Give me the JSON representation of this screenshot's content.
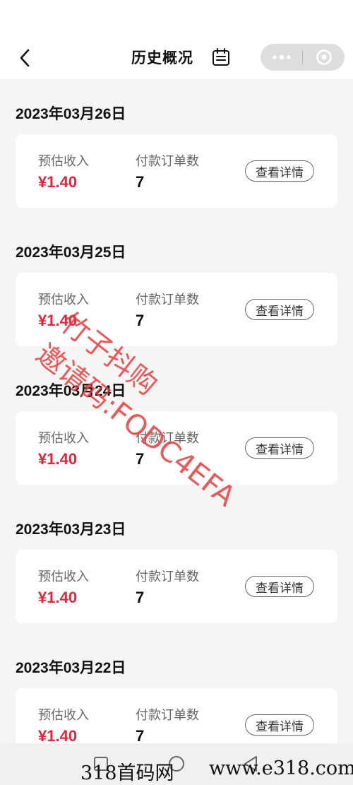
{
  "header": {
    "title": "历史概况"
  },
  "icons": {
    "back": "chevron-left-icon",
    "calendar": "calendar-icon",
    "more": "more-dots-icon",
    "close": "target-close-icon"
  },
  "labels": {
    "income": "预估收入",
    "orders": "付款订单数",
    "detail": "查看详情"
  },
  "records": [
    {
      "date": "2023年03月26日",
      "income": "¥1.40",
      "orders": "7"
    },
    {
      "date": "2023年03月25日",
      "income": "¥1.40",
      "orders": "7"
    },
    {
      "date": "2023年03月24日",
      "income": "¥1.40",
      "orders": "7"
    },
    {
      "date": "2023年03月23日",
      "income": "¥1.40",
      "orders": "7"
    },
    {
      "date": "2023年03月22日",
      "income": "¥1.40",
      "orders": "7"
    }
  ],
  "watermark": {
    "line1": "邀请码:FODC4EFA",
    "line2": "竹子抖购"
  },
  "footer": {
    "left": "318首码网",
    "right": "www.e318.com"
  },
  "colors": {
    "income": "#e0253c",
    "background": "#f5f5f5",
    "card": "#ffffff"
  }
}
